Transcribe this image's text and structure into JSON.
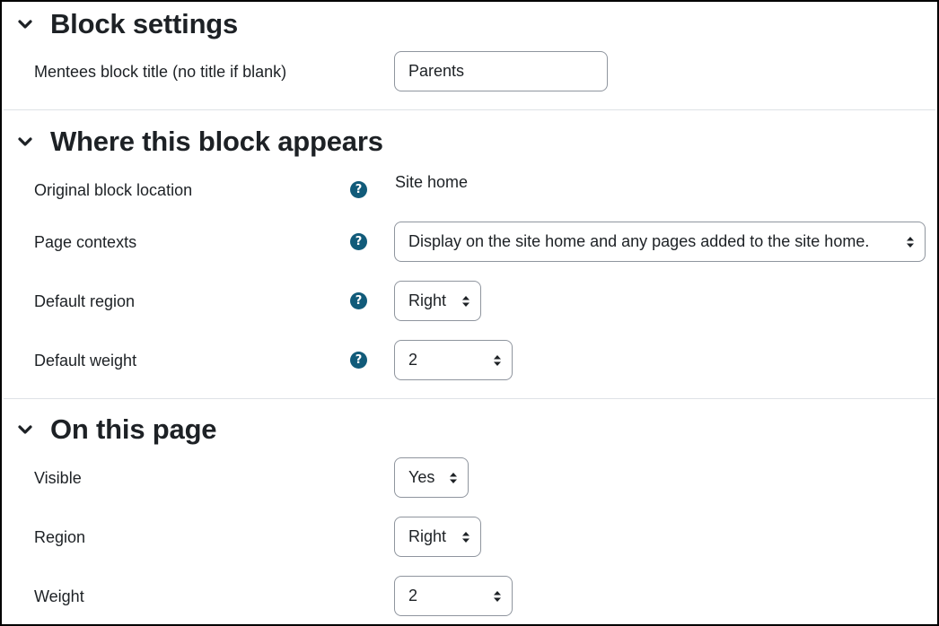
{
  "sections": {
    "block_settings": {
      "title": "Block settings",
      "title_label": "Mentees block title (no title if blank)",
      "title_value": "Parents"
    },
    "where_appears": {
      "title": "Where this block appears",
      "original_location_label": "Original block location",
      "original_location_value": "Site home",
      "page_contexts_label": "Page contexts",
      "page_contexts_value": "Display on the site home and any pages added to the site home.",
      "default_region_label": "Default region",
      "default_region_value": "Right",
      "default_weight_label": "Default weight",
      "default_weight_value": "2"
    },
    "on_this_page": {
      "title": "On this page",
      "visible_label": "Visible",
      "visible_value": "Yes",
      "region_label": "Region",
      "region_value": "Right",
      "weight_label": "Weight",
      "weight_value": "2"
    }
  },
  "icons": {
    "collapse": "chevron-down-icon",
    "help": "question-circle-icon",
    "select": "sort-arrows-icon"
  },
  "colors": {
    "help_icon": "#115b7a",
    "control_border": "#8f959e",
    "divider": "#dee2e6"
  }
}
